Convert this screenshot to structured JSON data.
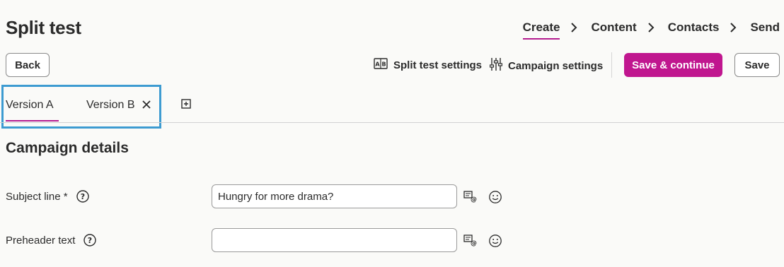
{
  "page": {
    "title": "Split test"
  },
  "steps": [
    {
      "label": "Create",
      "active": true
    },
    {
      "label": "Content",
      "active": false
    },
    {
      "label": "Contacts",
      "active": false
    },
    {
      "label": "Send",
      "active": false
    }
  ],
  "toolbar": {
    "back_label": "Back",
    "split_settings_label": "Split test settings",
    "split_settings_icon": "ab-compare-icon",
    "campaign_settings_label": "Campaign settings",
    "campaign_settings_icon": "sliders-icon",
    "save_continue_label": "Save & continue",
    "save_label": "Save"
  },
  "tabs": [
    {
      "label": "Version A",
      "selected": true,
      "closable": false
    },
    {
      "label": "Version B",
      "selected": false,
      "closable": true
    }
  ],
  "add_tab_icon": "plus-square-icon",
  "section": {
    "title": "Campaign details"
  },
  "fields": {
    "subject": {
      "label": "Subject line *",
      "value": "Hungry for more drama?",
      "placeholder": ""
    },
    "preheader": {
      "label": "Preheader text",
      "value": "",
      "placeholder": ""
    }
  },
  "colors": {
    "accent": "#c0168f",
    "highlight_box": "#3d9bd1",
    "background": "#fafaf8"
  }
}
